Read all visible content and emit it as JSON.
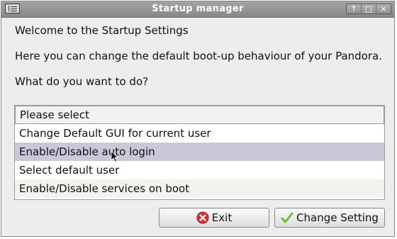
{
  "window": {
    "title": "Startup manager",
    "controls": {
      "up": "↑",
      "maximize": "□",
      "close": "×"
    }
  },
  "content": {
    "welcome": "Welcome to the Startup Settings",
    "description": "Here you can change the default boot-up behaviour of your Pandora.",
    "question": "What do you want to do?"
  },
  "options": [
    "Please select",
    "Change Default GUI for current user",
    "Enable/Disable auto login",
    "Select default user",
    "Enable/Disable services on boot"
  ],
  "selected_option": "Please select",
  "buttons": {
    "exit": "Exit",
    "change": "Change Setting"
  },
  "icons": {
    "exit": "x-circle-icon",
    "change": "checkmark-icon"
  },
  "colors": {
    "titlebar": "#999999",
    "hover_row": "#c8c8d8",
    "exit_icon": "#d93030",
    "check_icon": "#7ab83a"
  }
}
